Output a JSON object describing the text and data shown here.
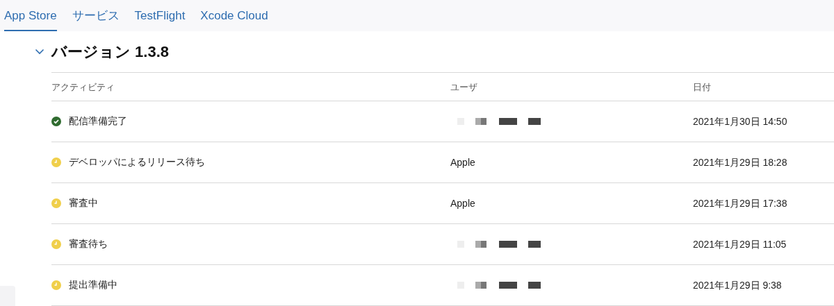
{
  "tabs": [
    {
      "label": "App Store",
      "selected": true
    },
    {
      "label": "サービス",
      "selected": false
    },
    {
      "label": "TestFlight",
      "selected": false
    },
    {
      "label": "Xcode Cloud",
      "selected": false
    }
  ],
  "section": {
    "title": "バージョン 1.3.8",
    "expanded": true
  },
  "table": {
    "columns": [
      "アクティビティ",
      "ユーザ",
      "日付"
    ],
    "rows": [
      {
        "kind": "done",
        "activity": "配信準備完了",
        "user": {
          "kind": "redacted"
        },
        "date": "2021年1月30日 14:50"
      },
      {
        "kind": "waiting",
        "activity": "デベロッパによるリリース待ち",
        "user": {
          "kind": "text",
          "text": "Apple"
        },
        "date": "2021年1月29日 18:28"
      },
      {
        "kind": "waiting",
        "activity": "審査中",
        "user": {
          "kind": "text",
          "text": "Apple"
        },
        "date": "2021年1月29日 17:38"
      },
      {
        "kind": "waiting",
        "activity": "審査待ち",
        "user": {
          "kind": "redacted"
        },
        "date": "2021年1月29日 11:05"
      },
      {
        "kind": "waiting",
        "activity": "提出準備中",
        "user": {
          "kind": "redacted"
        },
        "date": "2021年1月29日 9:38"
      }
    ]
  }
}
